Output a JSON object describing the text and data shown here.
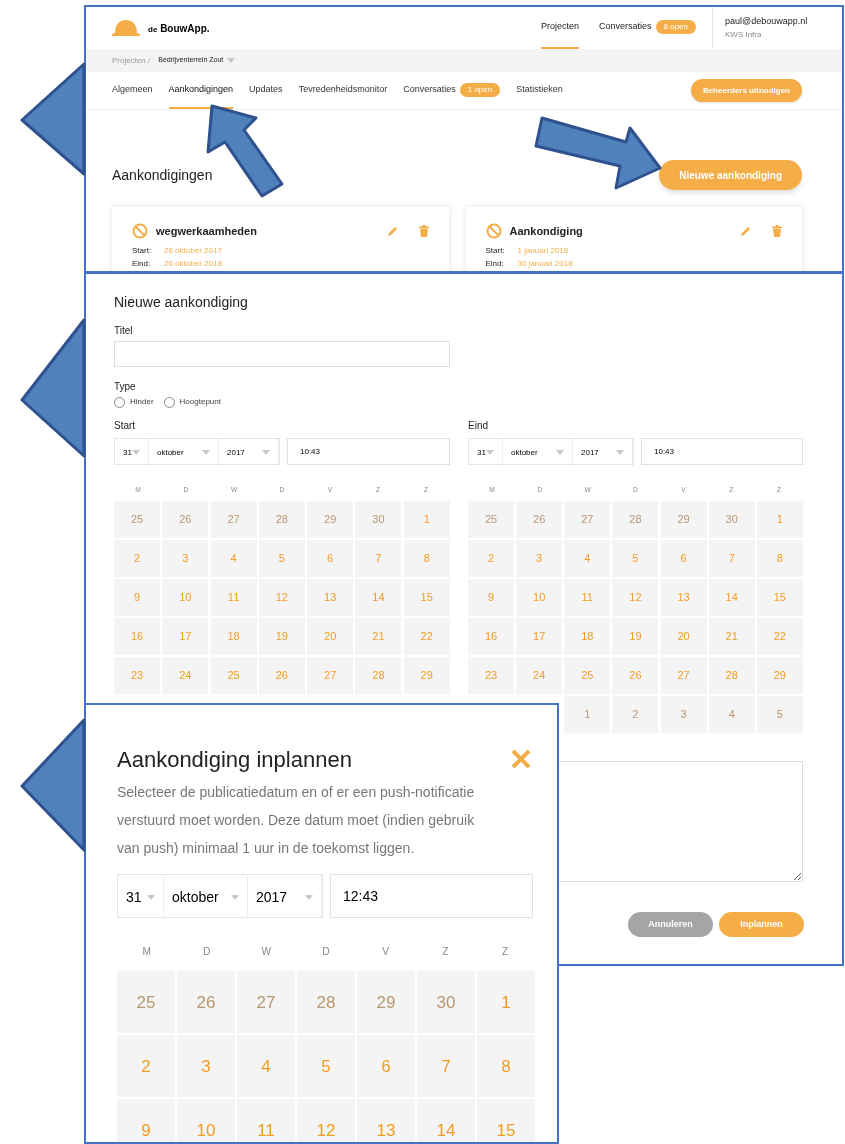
{
  "overview": {
    "logo": {
      "prefix": "de",
      "name": "BouwApp."
    },
    "top_nav": [
      {
        "label": "Projecten",
        "selected": true
      },
      {
        "label": "Conversaties",
        "badge": "8 open",
        "selected": false
      }
    ],
    "user": {
      "email": "paul@debouwapp.nl",
      "company": "KWS Infra"
    },
    "breadcrumb": {
      "root": "Projecten /",
      "current": "Bedrijventerrein Zout"
    },
    "tabs": [
      {
        "label": "Algemeen",
        "selected": false
      },
      {
        "label": "Aankondigingen",
        "selected": true
      },
      {
        "label": "Updates",
        "selected": false
      },
      {
        "label": "Tevredenheidsmonitor",
        "selected": false
      },
      {
        "label": "Conversaties",
        "badge": "1 open",
        "selected": false
      },
      {
        "label": "Statistieken",
        "selected": false
      }
    ],
    "invite_button": "Beheerders uitnodigen",
    "heading": "Aankondigingen",
    "new_button": "Nieuwe aankondiging",
    "cards": [
      {
        "title": "wegwerkaamheden",
        "start_label": "Start:",
        "start": "26 oktober 2017",
        "end_label": "Eind:",
        "end": "26 oktober 2018"
      },
      {
        "title": "Aankondiging",
        "start_label": "Start:",
        "start": "1 januari 2018",
        "end_label": "Eind:",
        "end": "30 januari 2018"
      }
    ]
  },
  "form": {
    "title": "Nieuwe aankondiging",
    "title_label": "Titel",
    "type_label": "Type",
    "types": [
      {
        "label": "Hinder",
        "checked": false
      },
      {
        "label": "Hoogtepunt",
        "checked": false
      }
    ],
    "ranges": [
      {
        "label": "Start",
        "day": "31",
        "month": "oktober",
        "year": "2017",
        "time": "10:43",
        "weekdays": [
          "M",
          "D",
          "W",
          "D",
          "V",
          "Z",
          "Z"
        ],
        "weeks": [
          [
            {
              "d": "25",
              "muted": true
            },
            {
              "d": "26",
              "muted": true
            },
            {
              "d": "27",
              "muted": true
            },
            {
              "d": "28",
              "muted": true
            },
            {
              "d": "29",
              "muted": true
            },
            {
              "d": "30",
              "muted": true
            },
            {
              "d": "1",
              "muted": false
            }
          ],
          [
            {
              "d": "2",
              "muted": false
            },
            {
              "d": "3",
              "muted": false
            },
            {
              "d": "4",
              "muted": false
            },
            {
              "d": "5",
              "muted": false
            },
            {
              "d": "6",
              "muted": false
            },
            {
              "d": "7",
              "muted": false
            },
            {
              "d": "8",
              "muted": false
            }
          ],
          [
            {
              "d": "9",
              "muted": false
            },
            {
              "d": "10",
              "muted": false
            },
            {
              "d": "11",
              "muted": false
            },
            {
              "d": "12",
              "muted": false
            },
            {
              "d": "13",
              "muted": false
            },
            {
              "d": "14",
              "muted": false
            },
            {
              "d": "15",
              "muted": false
            }
          ],
          [
            {
              "d": "16",
              "muted": false
            },
            {
              "d": "17",
              "muted": false
            },
            {
              "d": "18",
              "muted": false
            },
            {
              "d": "19",
              "muted": false
            },
            {
              "d": "20",
              "muted": false
            },
            {
              "d": "21",
              "muted": false
            },
            {
              "d": "22",
              "muted": false
            }
          ],
          [
            {
              "d": "23",
              "muted": false
            },
            {
              "d": "24",
              "muted": false
            },
            {
              "d": "25",
              "muted": false
            },
            {
              "d": "26",
              "muted": false
            },
            {
              "d": "27",
              "muted": false
            },
            {
              "d": "28",
              "muted": false
            },
            {
              "d": "29",
              "muted": false
            }
          ]
        ]
      },
      {
        "label": "Eind",
        "day": "31",
        "month": "oktober",
        "year": "2017",
        "time": "10:43",
        "weekdays": [
          "M",
          "D",
          "W",
          "D",
          "V",
          "Z",
          "Z"
        ],
        "weeks": [
          [
            {
              "d": "25",
              "muted": true
            },
            {
              "d": "26",
              "muted": true
            },
            {
              "d": "27",
              "muted": true
            },
            {
              "d": "28",
              "muted": true
            },
            {
              "d": "29",
              "muted": true
            },
            {
              "d": "30",
              "muted": true
            },
            {
              "d": "1",
              "muted": false
            }
          ],
          [
            {
              "d": "2",
              "muted": false
            },
            {
              "d": "3",
              "muted": false
            },
            {
              "d": "4",
              "muted": false
            },
            {
              "d": "5",
              "muted": false
            },
            {
              "d": "6",
              "muted": false
            },
            {
              "d": "7",
              "muted": false
            },
            {
              "d": "8",
              "muted": false
            }
          ],
          [
            {
              "d": "9",
              "muted": false
            },
            {
              "d": "10",
              "muted": false
            },
            {
              "d": "11",
              "muted": false
            },
            {
              "d": "12",
              "muted": false
            },
            {
              "d": "13",
              "muted": false
            },
            {
              "d": "14",
              "muted": false
            },
            {
              "d": "15",
              "muted": false
            }
          ],
          [
            {
              "d": "16",
              "muted": false
            },
            {
              "d": "17",
              "muted": false
            },
            {
              "d": "18",
              "muted": false
            },
            {
              "d": "19",
              "muted": false
            },
            {
              "d": "20",
              "muted": false
            },
            {
              "d": "21",
              "muted": false
            },
            {
              "d": "22",
              "muted": false
            }
          ],
          [
            {
              "d": "23",
              "muted": false
            },
            {
              "d": "24",
              "muted": false
            },
            {
              "d": "25",
              "muted": false
            },
            {
              "d": "26",
              "muted": false
            },
            {
              "d": "27",
              "muted": false
            },
            {
              "d": "28",
              "muted": false
            },
            {
              "d": "29",
              "muted": false
            }
          ],
          [
            {
              "d": "1",
              "muted": true
            },
            {
              "d": "2",
              "muted": true
            },
            {
              "d": "3",
              "muted": true
            },
            {
              "d": "4",
              "muted": true
            },
            {
              "d": "5",
              "muted": true
            }
          ]
        ]
      }
    ],
    "cancel_button": "Annuleren",
    "submit_button": "Inplannen"
  },
  "dialog": {
    "title": "Aankondiging inplannen",
    "text": "Selecteer de publicatiedatum en of er een push-notificatie verstuurd moet worden. Deze datum moet (indien gebruik van push) minimaal 1 uur in de toekomst liggen.",
    "day": "31",
    "month": "oktober",
    "year": "2017",
    "time": "12:43",
    "weekdays": [
      "M",
      "D",
      "W",
      "D",
      "V",
      "Z",
      "Z"
    ],
    "weeks": [
      [
        {
          "d": "25",
          "muted": true
        },
        {
          "d": "26",
          "muted": true
        },
        {
          "d": "27",
          "muted": true
        },
        {
          "d": "28",
          "muted": true
        },
        {
          "d": "29",
          "muted": true
        },
        {
          "d": "30",
          "muted": true
        },
        {
          "d": "1",
          "muted": false
        }
      ],
      [
        {
          "d": "2",
          "muted": false
        },
        {
          "d": "3",
          "muted": false
        },
        {
          "d": "4",
          "muted": false
        },
        {
          "d": "5",
          "muted": false
        },
        {
          "d": "6",
          "muted": false
        },
        {
          "d": "7",
          "muted": false
        },
        {
          "d": "8",
          "muted": false
        }
      ],
      [
        {
          "d": "9",
          "muted": false
        },
        {
          "d": "10",
          "muted": false
        },
        {
          "d": "11",
          "muted": false
        },
        {
          "d": "12",
          "muted": false
        },
        {
          "d": "13",
          "muted": false
        },
        {
          "d": "14",
          "muted": false
        },
        {
          "d": "15",
          "muted": false
        }
      ]
    ]
  }
}
